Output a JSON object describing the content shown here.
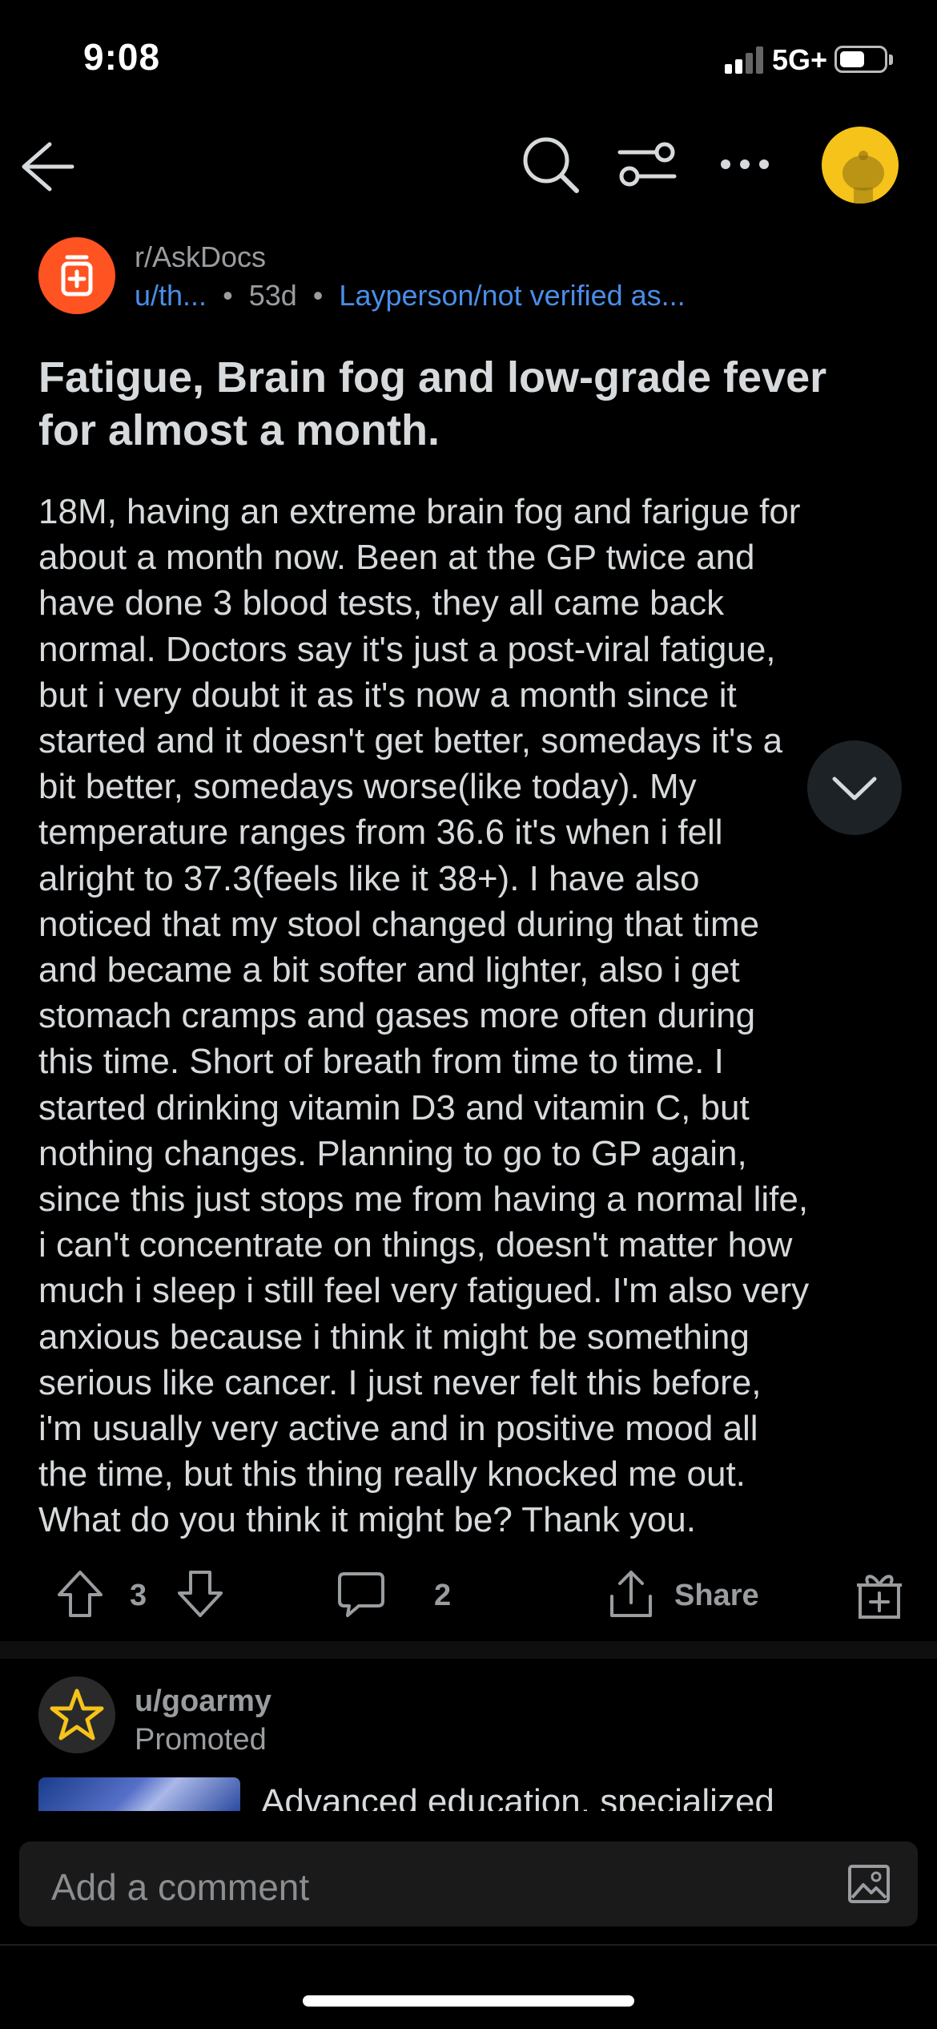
{
  "status_bar": {
    "time": "9:08",
    "network": "5G+",
    "icons": [
      "signal-icon",
      "battery-icon"
    ]
  },
  "nav": {
    "icons": [
      "back-arrow-icon",
      "search-icon",
      "sort-filter-icon",
      "more-options-icon",
      "profile-avatar-icon"
    ]
  },
  "post": {
    "subreddit": "r/AskDocs",
    "author": "u/th...",
    "age": "53d",
    "flair": "Layperson/not verified as...",
    "separator": "•",
    "title_lines": [
      "Fatigue, Brain fog and low-grade fever",
      "for almost a month."
    ],
    "body_lines": [
      "18M, having an extreme brain fog and farigue for",
      "about a month now. Been at the GP twice and",
      "have done 3 blood tests, they all came back",
      "normal. Doctors say it's just a post-viral fatigue,",
      "but i very doubt it as it's now a month since it",
      "started and it doesn't get better, somedays it's a",
      "bit better, somedays worse(like today). My",
      "temperature ranges from 36.6 it's when i fell",
      "alright to 37.3(feels like it 38+). I have also",
      "noticed that my stool changed during that time",
      "and became a bit softer and lighter, also i get",
      "stomach cramps and gases more often during",
      "this time. Short of breath from time to time. I",
      "started drinking vitamin D3 and vitamin C, but",
      "nothing changes. Planning to go to GP again,",
      "since this just stops me from having a normal life,",
      "i can't concentrate on things, doesn't matter how",
      "much i sleep i still feel very fatigued. I'm also very",
      "anxious because i think it might be something",
      "serious like cancer. I just never felt this before,",
      "i'm usually very active and in positive mood all",
      "the time, but this thing really knocked me out.",
      "What do you think it might be? Thank you."
    ],
    "upvotes": "3",
    "comments": "2",
    "share_label": "Share"
  },
  "promoted": {
    "user": "u/goarmy",
    "label": "Promoted",
    "text": "Advanced education, specialized"
  },
  "comment_bar": {
    "placeholder": "Add a comment"
  },
  "colors": {
    "background": "#000000",
    "text": "#d7dadc",
    "muted": "#9a9da0",
    "link": "#4a8ee8",
    "subreddit_icon": "#ff5322",
    "avatar": "#f5c319",
    "star": "#f5c319"
  }
}
